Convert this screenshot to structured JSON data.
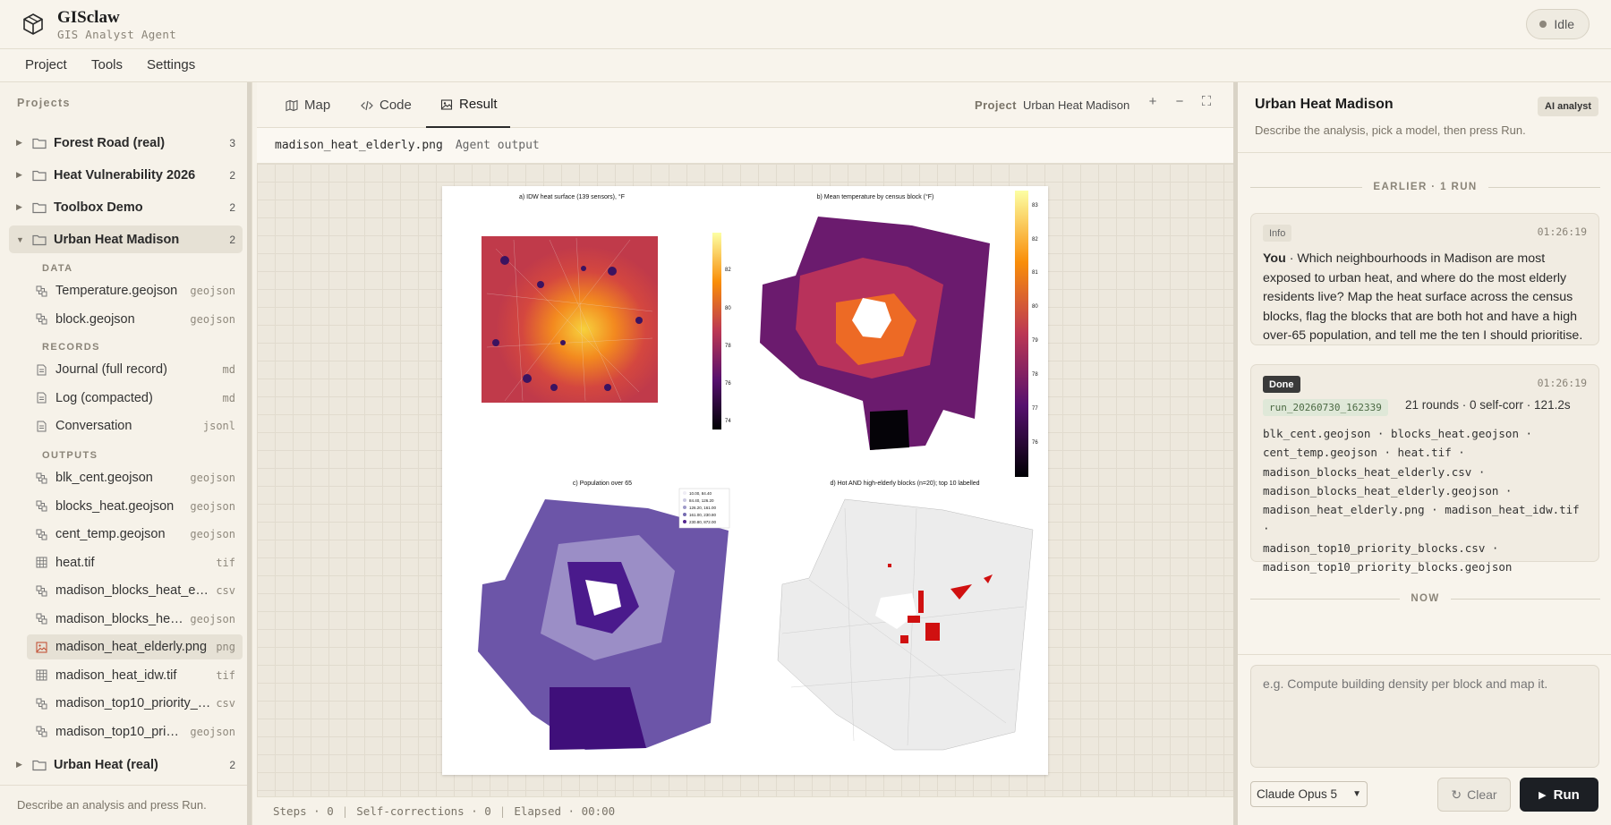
{
  "app": {
    "title": "GISclaw",
    "subtitle": "GIS Analyst Agent",
    "status": "Idle"
  },
  "menu": [
    "Project",
    "Tools",
    "Settings"
  ],
  "sidebar": {
    "heading": "Projects",
    "projects": [
      {
        "name": "Forest Road (real)",
        "count": "3",
        "expanded": false
      },
      {
        "name": "Heat Vulnerability 2026",
        "count": "2",
        "expanded": false
      },
      {
        "name": "Toolbox Demo",
        "count": "2",
        "expanded": false
      },
      {
        "name": "Urban Heat Madison",
        "count": "2",
        "expanded": true
      },
      {
        "name": "Urban Heat (real)",
        "count": "2",
        "expanded": false
      }
    ],
    "sections": {
      "data": "DATA",
      "records": "RECORDS",
      "outputs": "OUTPUTS"
    },
    "data_files": [
      {
        "name": "Temperature.geojson",
        "ext": "geojson",
        "icon": "layer-icon"
      },
      {
        "name": "block.geojson",
        "ext": "geojson",
        "icon": "layer-icon"
      }
    ],
    "record_files": [
      {
        "name": "Journal (full record)",
        "ext": "md",
        "icon": "document-icon"
      },
      {
        "name": "Log (compacted)",
        "ext": "md",
        "icon": "document-icon"
      },
      {
        "name": "Conversation",
        "ext": "jsonl",
        "icon": "document-icon"
      }
    ],
    "output_files": [
      {
        "name": "blk_cent.geojson",
        "ext": "geojson",
        "icon": "layer-icon"
      },
      {
        "name": "blocks_heat.geojson",
        "ext": "geojson",
        "icon": "layer-icon"
      },
      {
        "name": "cent_temp.geojson",
        "ext": "geojson",
        "icon": "layer-icon"
      },
      {
        "name": "heat.tif",
        "ext": "tif",
        "icon": "grid-icon"
      },
      {
        "name": "madison_blocks_heat_elderly.csv",
        "ext": "csv",
        "icon": "layer-icon"
      },
      {
        "name": "madison_blocks_heat_elderly.geojson",
        "ext": "geojson",
        "icon": "layer-icon"
      },
      {
        "name": "madison_heat_elderly.png",
        "ext": "png",
        "icon": "image-icon"
      },
      {
        "name": "madison_heat_idw.tif",
        "ext": "tif",
        "icon": "grid-icon"
      },
      {
        "name": "madison_top10_priority_blocks.csv",
        "ext": "csv",
        "icon": "layer-icon"
      },
      {
        "name": "madison_top10_priority_blocks.geojson",
        "ext": "geojson",
        "icon": "layer-icon"
      }
    ],
    "footer": "Describe an analysis and press Run."
  },
  "center": {
    "tabs": [
      "Map",
      "Code",
      "Result"
    ],
    "active_tab": "Result",
    "project_label": "Project",
    "project_name": "Urban Heat Madison",
    "controls": [
      "+",
      "−",
      "⛶"
    ],
    "file_name": "madison_heat_elderly.png",
    "file_tag": "Agent output",
    "figure": {
      "titles": [
        "a) IDW heat surface (139 sensors), °F",
        "b) Mean temperature by census block (°F)",
        "c) Population over 65",
        "d) Hot AND high-elderly blocks (n=20); top 10 labelled"
      ],
      "colorbar_a": [
        "82",
        "80",
        "78",
        "76",
        "74"
      ],
      "colorbar_b": [
        "83",
        "82",
        "81",
        "80",
        "79",
        "78",
        "77",
        "76"
      ],
      "legend_c": [
        "10.00,  84.40",
        "84.40,  126.20",
        "126.20,  161.00",
        "161.00,  230.80",
        "230.80,  872.00"
      ]
    },
    "status": {
      "steps": "Steps · 0",
      "self_corr": "Self-corrections · 0",
      "elapsed": "Elapsed · 00:00"
    }
  },
  "panel": {
    "title": "Urban Heat Madison",
    "badge": "AI analyst",
    "description": "Describe the analysis, pick a model, then press Run.",
    "earlier_divider": "EARLIER · 1 RUN",
    "message_card": {
      "tag": "Info",
      "time": "01:26:19",
      "speaker": "You",
      "text": "Which neighbourhoods in Madison are most exposed to urban heat, and where do the most elderly residents live? Map the heat surface across the census blocks, flag the blocks that are both hot and have a high over-65 population, and tell me the ten I should prioritise."
    },
    "run_card": {
      "tag": "Done",
      "time": "01:26:19",
      "run_id": "run_20260730_162339",
      "stats": "21 rounds · 0 self-corr · 121.2s",
      "files": [
        "blk_cent.geojson · blocks_heat.geojson ·",
        "cent_temp.geojson · heat.tif ·",
        "madison_blocks_heat_elderly.csv ·",
        "madison_blocks_heat_elderly.geojson ·",
        "madison_heat_elderly.png · madison_heat_idw.tif ·",
        "madison_top10_priority_blocks.csv ·",
        "madison_top10_priority_blocks.geojson"
      ]
    },
    "now_divider": "NOW",
    "prompt_placeholder": "e.g. Compute building density per block and map it.",
    "model": "Claude Opus 5",
    "clear_label": "Clear",
    "run_label": "Run"
  }
}
